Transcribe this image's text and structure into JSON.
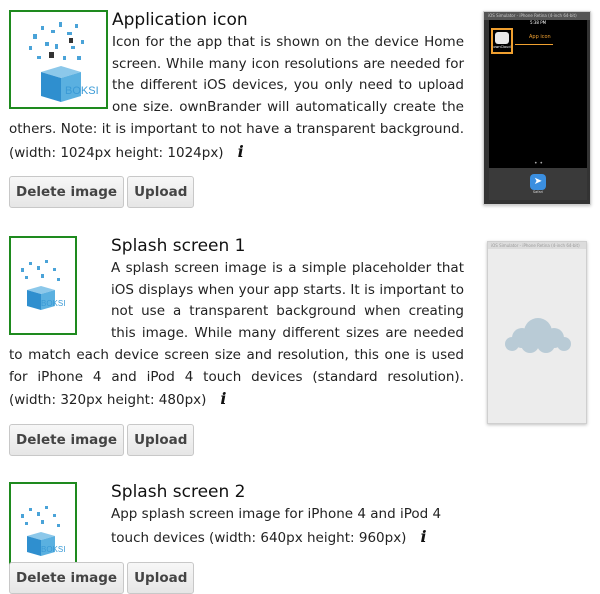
{
  "sections": [
    {
      "title": "Application icon",
      "description": "Icon for the app that is shown on the device Home screen. While many icon resolutions are needed for the different iOS devices, you only need to upload one size. ownBrander will automatically create the others. Note: it is important to not have a transparent background. (width: 1024px height: 1024px)",
      "info_icon": "i",
      "delete_label": "Delete image",
      "upload_label": "Upload",
      "thumb_text": "BOKSI",
      "preview": {
        "status_bar": "iOS Simulator - iPhone Retina (4-inch 64-bit)",
        "time": "5:38 PM",
        "app_label": "ownCloud",
        "callout": "App icon",
        "dock_label": "Safari"
      }
    },
    {
      "title": "Splash screen 1",
      "description": "A splash screen image is a simple placeholder that iOS displays when your app starts. It is important to not use a transparent background when creating this image. While many different sizes are needed to match each device screen size and resolution, this one is used for iPhone 4 and iPod 4 touch devices (standard resolution). (width: 320px height: 480px)",
      "info_icon": "i",
      "delete_label": "Delete image",
      "upload_label": "Upload",
      "thumb_text": "BOKSI",
      "preview": {
        "status_bar": "iOS Simulator - iPhone Retina (4-inch 64-bit)"
      }
    },
    {
      "title": "Splash screen 2",
      "description": "App splash screen image for iPhone 4 and iPod 4 touch devices (width: 640px height: 960px)",
      "info_icon": "i",
      "delete_label": "Delete image",
      "upload_label": "Upload",
      "thumb_text": "BOKSI"
    }
  ],
  "colors": {
    "thumb_border": "#1e8a1e",
    "callout": "#f0a030",
    "brand_blue": "#4aa3d8"
  }
}
